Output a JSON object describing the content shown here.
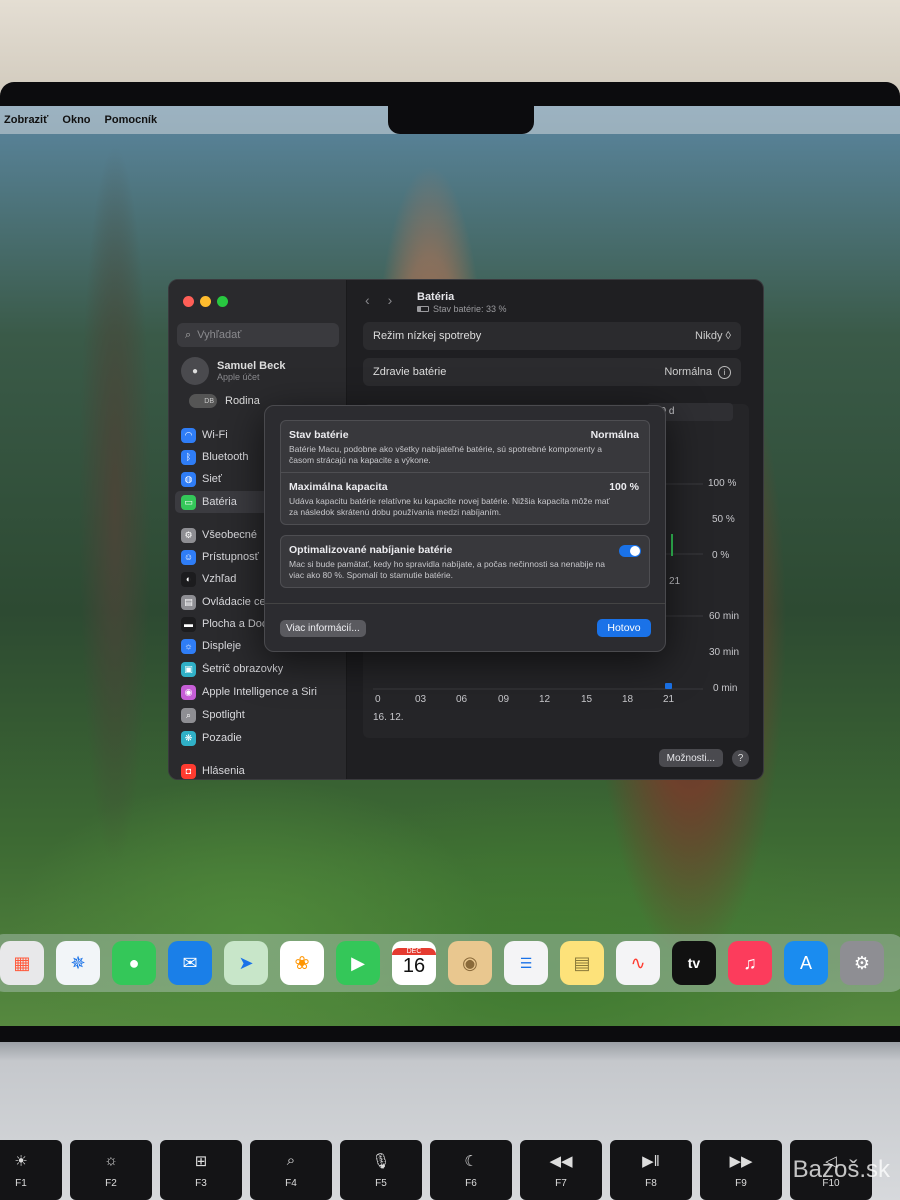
{
  "menubar": {
    "items": [
      "Zobraziť",
      "Okno",
      "Pomocník"
    ]
  },
  "sidebar": {
    "search_placeholder": "Vyhľadať",
    "user_name": "Samuel Beck",
    "user_sub": "Apple účet",
    "family_initials": "DB",
    "family_label": "Rodina",
    "items": [
      {
        "label": "Wi‑Fi",
        "icon": "wifi-icon",
        "color": "#2f7df6",
        "glyph": "◠"
      },
      {
        "label": "Bluetooth",
        "icon": "bluetooth-icon",
        "color": "#2f7df6",
        "glyph": "ᛒ"
      },
      {
        "label": "Sieť",
        "icon": "network-icon",
        "color": "#2f7df6",
        "glyph": "◍"
      },
      {
        "label": "Batéria",
        "icon": "battery-icon",
        "color": "#34c759",
        "glyph": "▭"
      },
      {
        "label": "Všeobecné",
        "icon": "gear-icon",
        "color": "#8e8e93",
        "glyph": "⚙"
      },
      {
        "label": "Prístupnosť",
        "icon": "accessibility-icon",
        "color": "#2f7df6",
        "glyph": "☺"
      },
      {
        "label": "Vzhľad",
        "icon": "appearance-icon",
        "color": "#1c1c1e",
        "glyph": "◐"
      },
      {
        "label": "Ovládacie ce",
        "icon": "control-center-icon",
        "color": "#8e8e93",
        "glyph": "▤"
      },
      {
        "label": "Plocha a Doc",
        "icon": "desktop-dock-icon",
        "color": "#1c1c1e",
        "glyph": "▬"
      },
      {
        "label": "Displeje",
        "icon": "display-icon",
        "color": "#2f7df6",
        "glyph": "☼"
      },
      {
        "label": "Šetrič obrazovky",
        "icon": "screensaver-icon",
        "color": "#30b0c7",
        "glyph": "▣"
      },
      {
        "label": "Apple Intelligence a Siri",
        "icon": "siri-icon",
        "color": "#c65ed6",
        "glyph": "◉"
      },
      {
        "label": "Spotlight",
        "icon": "spotlight-icon",
        "color": "#8e8e93",
        "glyph": "⌕"
      },
      {
        "label": "Pozadie",
        "icon": "wallpaper-icon",
        "color": "#30b0c7",
        "glyph": "❋"
      },
      {
        "label": "Hlásenia",
        "icon": "notifications-icon",
        "color": "#ff3b30",
        "glyph": "◘"
      }
    ]
  },
  "page": {
    "title": "Batéria",
    "subtitle": "Stav batérie: 33 %",
    "rows": [
      {
        "label": "Režim nízkej spotreby",
        "value": "Nikdy ◊"
      },
      {
        "label": "Zdravie batérie",
        "value": "Normálna"
      }
    ],
    "range_button": "10 d",
    "level_axis": [
      "100 %",
      "50 %",
      "0 %"
    ],
    "level_tick": "21",
    "usage_axis": [
      "60 min",
      "30 min",
      "0 min"
    ],
    "hours": [
      "0",
      "03",
      "06",
      "09",
      "12",
      "15",
      "18",
      "21"
    ],
    "date": "16. 12.",
    "options_button": "Možnosti...",
    "help": "?"
  },
  "dialog": {
    "sections": [
      {
        "title": "Stav batérie",
        "value": "Normálna",
        "desc": "Batérie Macu, podobne ako všetky nabíjateľné batérie, sú spotrebné komponenty a časom strácajú na kapacite a výkone."
      },
      {
        "title": "Maximálna kapacita",
        "value": "100 %",
        "desc": "Udáva kapacitu batérie relatívne ku kapacite novej batérie. Nižšia kapacita môže mať za následok skrátenú dobu používania medzi nabíjaním."
      }
    ],
    "optimized": {
      "title": "Optimalizované nabíjanie batérie",
      "desc": "Mac si bude pamätať, kedy ho spravidla nabíjate, a počas nečinnosti sa nenabije na viac ako 80 %. Spomalí to starnutie batérie.",
      "enabled": true
    },
    "more_button": "Viac informácií...",
    "done_button": "Hotovo"
  },
  "dock": {
    "calendar_month": "DEC",
    "calendar_day": "16",
    "apple_tv_label": "tv"
  },
  "keyboard": {
    "keys": [
      {
        "sym": "☀",
        "label": "F1"
      },
      {
        "sym": "☼",
        "label": "F2"
      },
      {
        "sym": "⊞",
        "label": "F3"
      },
      {
        "sym": "⌕",
        "label": "F4"
      },
      {
        "sym": "🎙",
        "label": "F5"
      },
      {
        "sym": "☾",
        "label": "F6"
      },
      {
        "sym": "◀◀",
        "label": "F7"
      },
      {
        "sym": "▶‖",
        "label": "F8"
      },
      {
        "sym": "▶▶",
        "label": "F9"
      },
      {
        "sym": "◁",
        "label": "F10"
      }
    ]
  },
  "watermark": "Bazoš.sk"
}
